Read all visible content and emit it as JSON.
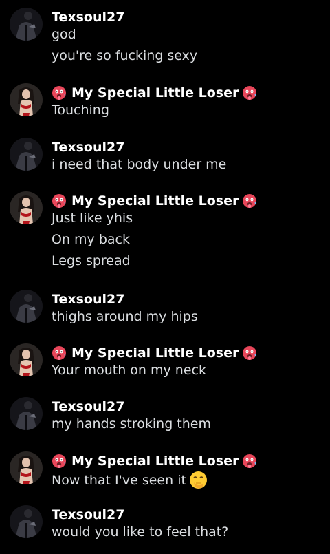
{
  "colors": {
    "background": "#000000",
    "username": "#ffffff",
    "message_text": "#dbdee1"
  },
  "users": {
    "a": {
      "name": "Texsoul27",
      "avatar_icon": "avatar-suit-man-icon"
    },
    "b": {
      "name": "My Special Little Loser",
      "avatar_icon": "avatar-woman-red-lingerie-icon",
      "name_emoji": "hot-face-emoji-icon"
    }
  },
  "messages": [
    {
      "author": "Texsoul27",
      "lines": [
        "god",
        "you're so fucking sexy"
      ]
    },
    {
      "author": "My Special Little Loser",
      "lines": [
        "Touching"
      ]
    },
    {
      "author": "Texsoul27",
      "lines": [
        "i need that body under me"
      ]
    },
    {
      "author": "My Special Little Loser",
      "lines": [
        "Just like yhis",
        "On my back",
        "Legs spread"
      ]
    },
    {
      "author": "Texsoul27",
      "lines": [
        "thighs around my hips"
      ]
    },
    {
      "author": "My Special Little Loser",
      "lines": [
        "Your mouth on my neck"
      ]
    },
    {
      "author": "Texsoul27",
      "lines": [
        "my hands stroking them"
      ]
    },
    {
      "author": "My Special Little Loser",
      "lines": [
        "Now that I've seen it"
      ],
      "trailing_emoji": "face-with-hand-over-mouth-emoji-icon"
    },
    {
      "author": "Texsoul27",
      "lines": [
        "would you like to feel that?"
      ]
    }
  ]
}
